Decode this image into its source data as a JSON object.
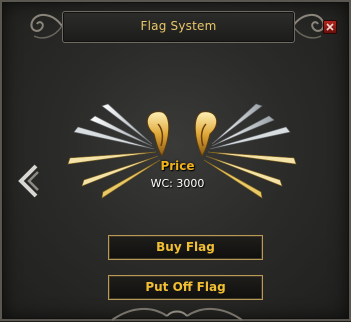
{
  "window": {
    "title": "Flag System"
  },
  "icons": {
    "close": "close-icon",
    "nav_left": "chevron-left-icon",
    "flag_preview": "wings-flag-image"
  },
  "price": {
    "label": "Price",
    "value": "WC: 3000"
  },
  "buttons": {
    "buy_label": "Buy Flag",
    "put_off_label": "Put Off Flag"
  },
  "colors": {
    "title": "#e8c66a",
    "price_label": "#f0b21c",
    "button_text": "#f2bf32",
    "button_border": "#b99a54",
    "close_button": "#b3261e"
  }
}
